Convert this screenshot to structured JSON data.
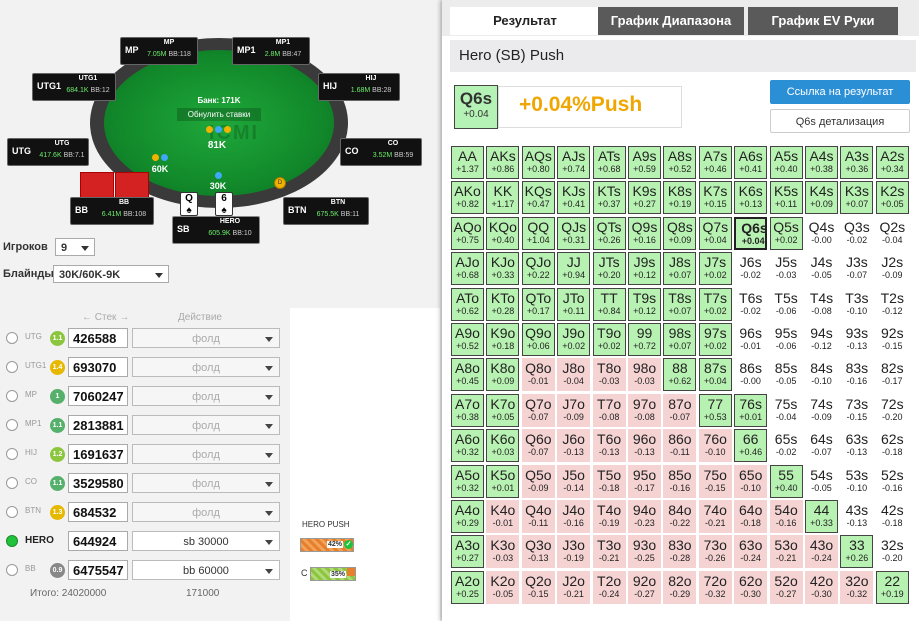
{
  "table": {
    "bank": "Банк: 171K",
    "reset_bets": "Обнулить ставки",
    "pot": "81K",
    "watermark": "ICMI",
    "chips_mp1": "60K",
    "chips_hero": "30K",
    "seats": {
      "MP": {
        "name": "MP",
        "stack": "7.05M",
        "bb": "BB:118"
      },
      "MP1": {
        "name": "MP1",
        "stack": "2.8M",
        "bb": "BB:47"
      },
      "UTG1": {
        "name": "UTG1",
        "stack": "684.1K",
        "bb": "BB:12"
      },
      "HIJ": {
        "name": "HIJ",
        "stack": "1.68M",
        "bb": "BB:28"
      },
      "UTG": {
        "name": "UTG",
        "stack": "417.6K",
        "bb": "BB:7.1"
      },
      "CO": {
        "name": "CO",
        "stack": "3.52M",
        "bb": "BB:59"
      },
      "BB": {
        "name": "BB",
        "stack": "6.41M",
        "bb": "BB:108"
      },
      "BTN": {
        "name": "BTN",
        "stack": "675.5K",
        "bb": "BB:11"
      },
      "HERO": {
        "name": "HERO",
        "stack": "605.9K",
        "bb": "BB:10"
      }
    },
    "pos_labels": {
      "MP": "MP",
      "MP1": "MP1",
      "UTG1": "UTG1",
      "HIJ": "HIJ",
      "UTG": "UTG",
      "CO": "CO",
      "BB": "BB",
      "BTN": "BTN",
      "SB": "SB"
    },
    "hero_cards": [
      "Q",
      "6"
    ],
    "dealer": "D"
  },
  "controls": {
    "players_label": "Игроков",
    "players_value": "9",
    "blinds_label": "Блайнды",
    "blinds_value": "30K/60K-9K",
    "stack_header": "Стек",
    "action_header": "Действие",
    "total_label": "Итого: 24020000",
    "total_action": "171000"
  },
  "rows": [
    {
      "pos": "UTG",
      "badge": "1.1",
      "badge_color": "#8cc63f",
      "stack": "426588",
      "action": "фолд",
      "active": false
    },
    {
      "pos": "UTG1",
      "badge": "1.4",
      "badge_color": "#e6b800",
      "stack": "693070",
      "action": "фолд",
      "active": false
    },
    {
      "pos": "MP",
      "badge": "1",
      "badge_color": "#55b06b",
      "stack": "7060247",
      "action": "фолд",
      "active": false
    },
    {
      "pos": "MP1",
      "badge": "1.1",
      "badge_color": "#55b06b",
      "stack": "2813881",
      "action": "фолд",
      "active": false
    },
    {
      "pos": "HIJ",
      "badge": "1.2",
      "badge_color": "#8cc63f",
      "stack": "1691637",
      "action": "фолд",
      "active": false
    },
    {
      "pos": "CO",
      "badge": "1.1",
      "badge_color": "#55b06b",
      "stack": "3529580",
      "action": "фолд",
      "active": false
    },
    {
      "pos": "BTN",
      "badge": "1.3",
      "badge_color": "#e6b800",
      "stack": "684532",
      "action": "фолд",
      "active": false
    },
    {
      "pos": "HERO",
      "badge": "",
      "badge_color": "#1fc23a",
      "stack": "644924",
      "action": "sb 30000",
      "active": true
    },
    {
      "pos": "BB",
      "badge": "0.9",
      "badge_color": "#888888",
      "stack": "6475547",
      "action": "bb 60000",
      "active": false
    }
  ],
  "push_panel": {
    "title": "HERO PUSH",
    "push_pct": "42%",
    "call_label": "C",
    "call_pct": "35%"
  },
  "tabs": [
    "Результат",
    "График Диапазона",
    "График EV Руки"
  ],
  "result": {
    "header": "Hero (SB) Push",
    "hand": "Q6s",
    "hand_ev": "+0.04",
    "ev_text": "+0.04%Push",
    "link_button": "Ссылка на результат",
    "detail_button": "Q6s детализация"
  },
  "grid": [
    [
      [
        "AA",
        "+1.37"
      ],
      [
        "AKs",
        "+0.86"
      ],
      [
        "AQs",
        "+0.80"
      ],
      [
        "AJs",
        "+0.74"
      ],
      [
        "ATs",
        "+0.68"
      ],
      [
        "A9s",
        "+0.59"
      ],
      [
        "A8s",
        "+0.52"
      ],
      [
        "A7s",
        "+0.46"
      ],
      [
        "A6s",
        "+0.41"
      ],
      [
        "A5s",
        "+0.40"
      ],
      [
        "A4s",
        "+0.38"
      ],
      [
        "A3s",
        "+0.36"
      ],
      [
        "A2s",
        "+0.34"
      ]
    ],
    [
      [
        "AKo",
        "+0.82"
      ],
      [
        "KK",
        "+1.17"
      ],
      [
        "KQs",
        "+0.47"
      ],
      [
        "KJs",
        "+0.41"
      ],
      [
        "KTs",
        "+0.37"
      ],
      [
        "K9s",
        "+0.27"
      ],
      [
        "K8s",
        "+0.19"
      ],
      [
        "K7s",
        "+0.15"
      ],
      [
        "K6s",
        "+0.13"
      ],
      [
        "K5s",
        "+0.11"
      ],
      [
        "K4s",
        "+0.09"
      ],
      [
        "K3s",
        "+0.07"
      ],
      [
        "K2s",
        "+0.05"
      ]
    ],
    [
      [
        "AQo",
        "+0.75"
      ],
      [
        "KQo",
        "+0.40"
      ],
      [
        "QQ",
        "+1.04"
      ],
      [
        "QJs",
        "+0.31"
      ],
      [
        "QTs",
        "+0.26"
      ],
      [
        "Q9s",
        "+0.16"
      ],
      [
        "Q8s",
        "+0.09"
      ],
      [
        "Q7s",
        "+0.04"
      ],
      [
        "Q6s",
        "+0.04"
      ],
      [
        "Q5s",
        "+0.02"
      ],
      [
        "Q4s",
        "-0.00"
      ],
      [
        "Q3s",
        "-0.02"
      ],
      [
        "Q2s",
        "-0.04"
      ]
    ],
    [
      [
        "AJo",
        "+0.68"
      ],
      [
        "KJo",
        "+0.33"
      ],
      [
        "QJo",
        "+0.22"
      ],
      [
        "JJ",
        "+0.94"
      ],
      [
        "JTs",
        "+0.20"
      ],
      [
        "J9s",
        "+0.12"
      ],
      [
        "J8s",
        "+0.07"
      ],
      [
        "J7s",
        "+0.02"
      ],
      [
        "J6s",
        "-0.02"
      ],
      [
        "J5s",
        "-0.03"
      ],
      [
        "J4s",
        "-0.05"
      ],
      [
        "J3s",
        "-0.07"
      ],
      [
        "J2s",
        "-0.09"
      ]
    ],
    [
      [
        "ATo",
        "+0.62"
      ],
      [
        "KTo",
        "+0.28"
      ],
      [
        "QTo",
        "+0.17"
      ],
      [
        "JTo",
        "+0.11"
      ],
      [
        "TT",
        "+0.84"
      ],
      [
        "T9s",
        "+0.12"
      ],
      [
        "T8s",
        "+0.07"
      ],
      [
        "T7s",
        "+0.02"
      ],
      [
        "T6s",
        "-0.02"
      ],
      [
        "T5s",
        "-0.06"
      ],
      [
        "T4s",
        "-0.08"
      ],
      [
        "T3s",
        "-0.10"
      ],
      [
        "T2s",
        "-0.12"
      ]
    ],
    [
      [
        "A9o",
        "+0.52"
      ],
      [
        "K9o",
        "+0.18"
      ],
      [
        "Q9o",
        "+0.06"
      ],
      [
        "J9o",
        "+0.02"
      ],
      [
        "T9o",
        "+0.02"
      ],
      [
        "99",
        "+0.72"
      ],
      [
        "98s",
        "+0.07"
      ],
      [
        "97s",
        "+0.02"
      ],
      [
        "96s",
        "-0.01"
      ],
      [
        "95s",
        "-0.06"
      ],
      [
        "94s",
        "-0.12"
      ],
      [
        "93s",
        "-0.13"
      ],
      [
        "92s",
        "-0.15"
      ]
    ],
    [
      [
        "A8o",
        "+0.45"
      ],
      [
        "K8o",
        "+0.09"
      ],
      [
        "Q8o",
        "-0.01"
      ],
      [
        "J8o",
        "-0.04"
      ],
      [
        "T8o",
        "-0.03"
      ],
      [
        "98o",
        "-0.03"
      ],
      [
        "88",
        "+0.62"
      ],
      [
        "87s",
        "+0.04"
      ],
      [
        "86s",
        "-0.00"
      ],
      [
        "85s",
        "-0.05"
      ],
      [
        "84s",
        "-0.10"
      ],
      [
        "83s",
        "-0.16"
      ],
      [
        "82s",
        "-0.17"
      ]
    ],
    [
      [
        "A7o",
        "+0.38"
      ],
      [
        "K7o",
        "+0.05"
      ],
      [
        "Q7o",
        "-0.07"
      ],
      [
        "J7o",
        "-0.09"
      ],
      [
        "T7o",
        "-0.08"
      ],
      [
        "97o",
        "-0.08"
      ],
      [
        "87o",
        "-0.07"
      ],
      [
        "77",
        "+0.53"
      ],
      [
        "76s",
        "+0.01"
      ],
      [
        "75s",
        "-0.04"
      ],
      [
        "74s",
        "-0.09"
      ],
      [
        "73s",
        "-0.15"
      ],
      [
        "72s",
        "-0.20"
      ]
    ],
    [
      [
        "A6o",
        "+0.32"
      ],
      [
        "K6o",
        "+0.03"
      ],
      [
        "Q6o",
        "-0.07"
      ],
      [
        "J6o",
        "-0.13"
      ],
      [
        "T6o",
        "-0.13"
      ],
      [
        "96o",
        "-0.13"
      ],
      [
        "86o",
        "-0.11"
      ],
      [
        "76o",
        "-0.10"
      ],
      [
        "66",
        "+0.46"
      ],
      [
        "65s",
        "-0.02"
      ],
      [
        "64s",
        "-0.07"
      ],
      [
        "63s",
        "-0.13"
      ],
      [
        "62s",
        "-0.18"
      ]
    ],
    [
      [
        "A5o",
        "+0.32"
      ],
      [
        "K5o",
        "+0.01"
      ],
      [
        "Q5o",
        "-0.09"
      ],
      [
        "J5o",
        "-0.14"
      ],
      [
        "T5o",
        "-0.18"
      ],
      [
        "95o",
        "-0.17"
      ],
      [
        "85o",
        "-0.16"
      ],
      [
        "75o",
        "-0.15"
      ],
      [
        "65o",
        "-0.10"
      ],
      [
        "55",
        "+0.40"
      ],
      [
        "54s",
        "-0.05"
      ],
      [
        "53s",
        "-0.10"
      ],
      [
        "52s",
        "-0.16"
      ]
    ],
    [
      [
        "A4o",
        "+0.29"
      ],
      [
        "K4o",
        "-0.01"
      ],
      [
        "Q4o",
        "-0.11"
      ],
      [
        "J4o",
        "-0.16"
      ],
      [
        "T4o",
        "-0.19"
      ],
      [
        "94o",
        "-0.23"
      ],
      [
        "84o",
        "-0.22"
      ],
      [
        "74o",
        "-0.21"
      ],
      [
        "64o",
        "-0.18"
      ],
      [
        "54o",
        "-0.16"
      ],
      [
        "44",
        "+0.33"
      ],
      [
        "43s",
        "-0.13"
      ],
      [
        "42s",
        "-0.18"
      ]
    ],
    [
      [
        "A3o",
        "+0.27"
      ],
      [
        "K3o",
        "-0.03"
      ],
      [
        "Q3o",
        "-0.13"
      ],
      [
        "J3o",
        "-0.19"
      ],
      [
        "T3o",
        "-0.21"
      ],
      [
        "93o",
        "-0.25"
      ],
      [
        "83o",
        "-0.28"
      ],
      [
        "73o",
        "-0.26"
      ],
      [
        "63o",
        "-0.24"
      ],
      [
        "53o",
        "-0.21"
      ],
      [
        "43o",
        "-0.24"
      ],
      [
        "33",
        "+0.26"
      ],
      [
        "32s",
        "-0.20"
      ]
    ],
    [
      [
        "A2o",
        "+0.25"
      ],
      [
        "K2o",
        "-0.05"
      ],
      [
        "Q2o",
        "-0.15"
      ],
      [
        "J2o",
        "-0.21"
      ],
      [
        "T2o",
        "-0.24"
      ],
      [
        "92o",
        "-0.27"
      ],
      [
        "82o",
        "-0.29"
      ],
      [
        "72o",
        "-0.32"
      ],
      [
        "62o",
        "-0.30"
      ],
      [
        "52o",
        "-0.27"
      ],
      [
        "42o",
        "-0.30"
      ],
      [
        "32o",
        "-0.32"
      ],
      [
        "22",
        "+0.19"
      ]
    ]
  ],
  "colors": {
    "push": "#b8f2b2",
    "fold": "#f6d3d3",
    "ev_text": "#f0a600",
    "link_button": "#2b8fd6"
  }
}
